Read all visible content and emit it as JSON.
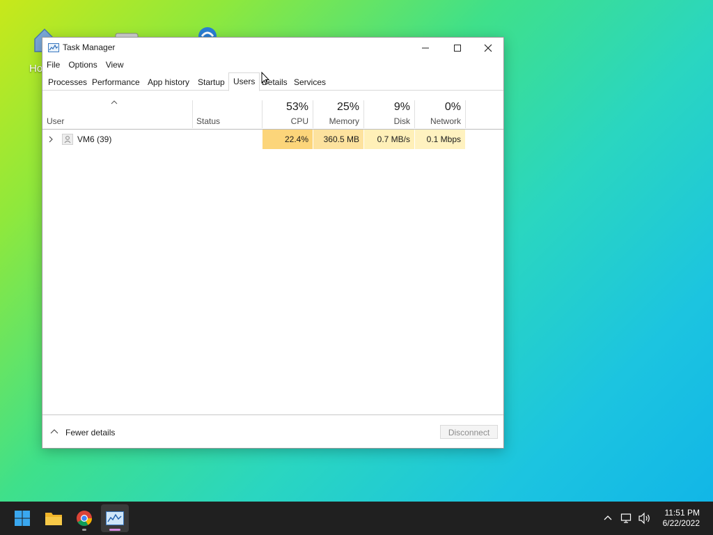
{
  "desktop": {
    "partial_label": "Ho"
  },
  "window": {
    "title": "Task Manager",
    "menu": [
      "File",
      "Options",
      "View"
    ],
    "tabs": [
      "Processes",
      "Performance",
      "App history",
      "Startup",
      "Users",
      "Details",
      "Services"
    ],
    "active_tab": "Users",
    "columns": {
      "user": "User",
      "status": "Status",
      "cpu": {
        "percent": "53%",
        "name": "CPU"
      },
      "memory": {
        "percent": "25%",
        "name": "Memory"
      },
      "disk": {
        "percent": "9%",
        "name": "Disk"
      },
      "network": {
        "percent": "0%",
        "name": "Network"
      }
    },
    "rows": [
      {
        "user": "VM6 (39)",
        "status": "",
        "cpu": "22.4%",
        "memory": "360.5 MB",
        "disk": "0.7 MB/s",
        "network": "0.1 Mbps"
      }
    ],
    "footer": {
      "fewer_details": "Fewer details",
      "disconnect": "Disconnect"
    }
  },
  "taskbar": {
    "apps": [
      "start-icon",
      "file-explorer-icon",
      "chrome-icon",
      "task-manager-icon"
    ],
    "time": "11:51 PM",
    "date": "6/22/2022"
  },
  "colors": {
    "cpu_cell": "#fcd57a",
    "memory_cell": "#fde29e",
    "disk_cell": "#fff0b8",
    "network_cell": "#fff2c0",
    "taskbar": "#202020"
  }
}
